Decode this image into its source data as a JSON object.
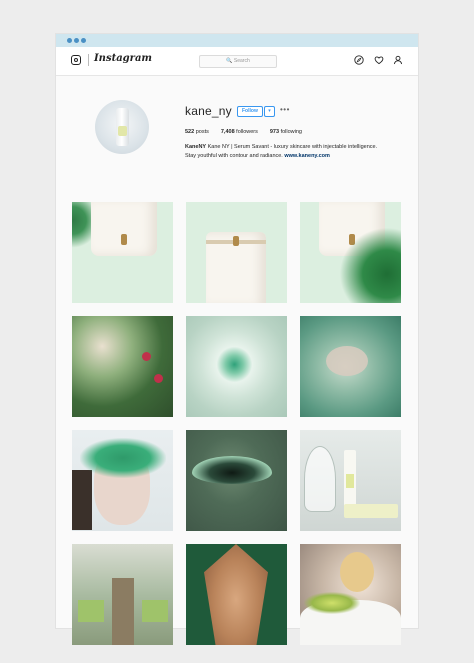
{
  "app": {
    "wordmark": "Instagram"
  },
  "nav": {
    "search_placeholder": "🔍 Search",
    "icons": [
      "compass-icon",
      "heart-icon",
      "person-icon"
    ]
  },
  "profile": {
    "username": "kane_ny",
    "follow_label": "Follow",
    "dropdown_label": "▾",
    "more_label": "•••",
    "stats": {
      "posts_count": "522",
      "posts_label": " posts",
      "followers_count": "7,408",
      "followers_label": " followers",
      "following_count": "973",
      "following_label": " following"
    },
    "bio": {
      "name": "KaneNY",
      "line1_rest": " Kane NY | Serum Savant - luxury skincare with injectable intelligence.",
      "line2": "Stay youthful with contour and radiance. ",
      "link": "www.kaneny.com"
    }
  },
  "colors": {
    "accent": "#3897f0",
    "chrome": "#cfe6ef",
    "link": "#003569"
  }
}
